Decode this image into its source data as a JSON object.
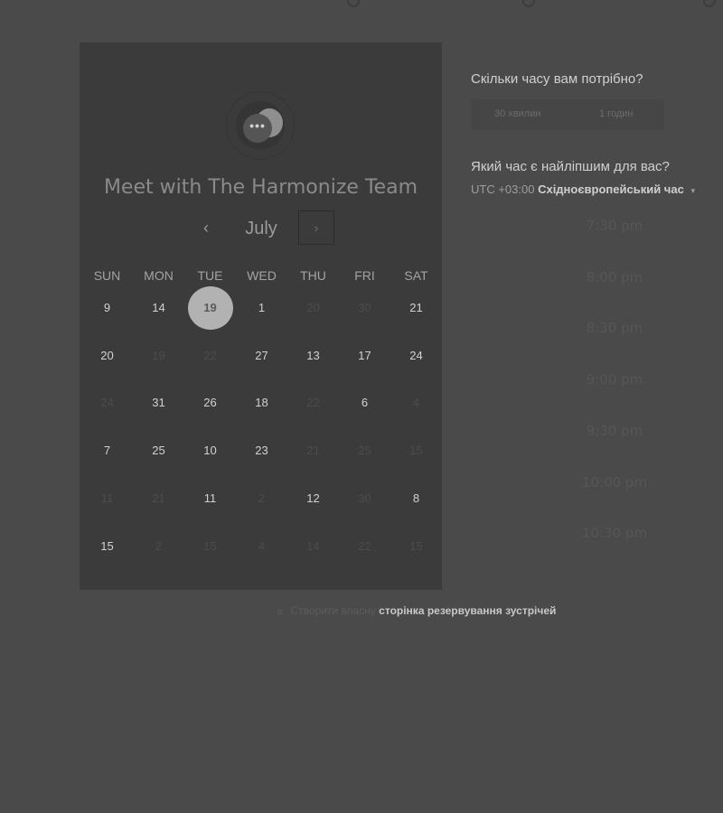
{
  "card": {
    "title": "Meet with The Harmonize Team",
    "avatar_icon": "chat-bubbles-icon",
    "avatar_glyph": "•••"
  },
  "calendar": {
    "month": "July",
    "prev_glyph": "‹",
    "next_glyph": "›",
    "weekdays": [
      "SUN",
      "MON",
      "TUE",
      "WED",
      "THU",
      "FRI",
      "SAT"
    ],
    "rows": [
      [
        {
          "d": "9"
        },
        {
          "d": "14"
        },
        {
          "d": "19",
          "sel": true
        },
        {
          "d": "1"
        },
        {
          "d": "20",
          "m": true
        },
        {
          "d": "30",
          "m": true
        },
        {
          "d": "21"
        }
      ],
      [
        {
          "d": "20"
        },
        {
          "d": "19",
          "m": true
        },
        {
          "d": "22",
          "m": true
        },
        {
          "d": "27"
        },
        {
          "d": "13"
        },
        {
          "d": "17"
        },
        {
          "d": "24"
        }
      ],
      [
        {
          "d": "24",
          "m": true
        },
        {
          "d": "31"
        },
        {
          "d": "26"
        },
        {
          "d": "18"
        },
        {
          "d": "22",
          "m": true
        },
        {
          "d": "6"
        },
        {
          "d": "4",
          "m": true
        }
      ],
      [
        {
          "d": "7"
        },
        {
          "d": "25"
        },
        {
          "d": "10"
        },
        {
          "d": "23"
        },
        {
          "d": "21",
          "m": true
        },
        {
          "d": "25",
          "m": true
        },
        {
          "d": "15",
          "m": true
        }
      ],
      [
        {
          "d": "11",
          "m": true
        },
        {
          "d": "21",
          "m": true
        },
        {
          "d": "11"
        },
        {
          "d": "2",
          "m": true
        },
        {
          "d": "12"
        },
        {
          "d": "30",
          "m": true
        },
        {
          "d": "8"
        }
      ],
      [
        {
          "d": "15"
        },
        {
          "d": "2",
          "m": true
        },
        {
          "d": "15",
          "m": true
        },
        {
          "d": "4",
          "m": true
        },
        {
          "d": "14",
          "m": true
        },
        {
          "d": "22",
          "m": true
        },
        {
          "d": "15",
          "m": true
        }
      ]
    ]
  },
  "duration": {
    "question": "Скільки часу вам потрібно?",
    "options": [
      "30 хвилин",
      "1 годин"
    ]
  },
  "time": {
    "question": "Який час є найліпшим для вас?",
    "tz_offset": "UTC +03:00",
    "tz_name": "Східноєвропейський час",
    "tz_caret": "▾",
    "slots": [
      "7:30 pm",
      "8:00 pm",
      "8:30 pm",
      "9:00 pm",
      "9:30 pm",
      "10:00 pm",
      "10:30 pm"
    ]
  },
  "footer": {
    "icon": "spark-icon",
    "icon_glyph": "☼",
    "prefix": "Створити власну",
    "link": "сторінка резервування зустрічей"
  },
  "colors": {
    "background": "#4a4a4a",
    "card": "#3b3b3b",
    "selected_day": "#b2b2b2"
  }
}
